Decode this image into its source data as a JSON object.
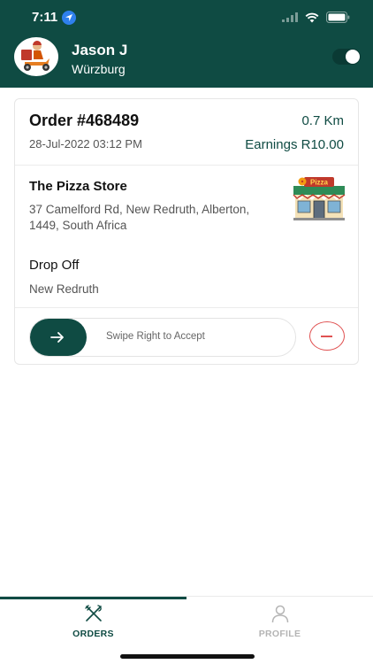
{
  "status_bar": {
    "time": "7:11",
    "icons": [
      "location-arrow-icon",
      "cellular-signal-icon",
      "wifi-icon",
      "battery-icon"
    ]
  },
  "header": {
    "driver_name": "Jason J",
    "driver_city": "Würzburg",
    "online_toggle": true,
    "avatar_icon": "delivery-scooter-avatar-icon",
    "colors": {
      "brand": "#0f4b43",
      "reject": "#e05252"
    }
  },
  "order": {
    "id": "Order #468489",
    "distance": "0.7 Km",
    "date": "28-Jul-2022 03:12 PM",
    "earnings": "Earnings R10.00",
    "store": {
      "name": "The Pizza Store",
      "address": "37 Camelford Rd, New Redruth, Alberton, 1449, South Africa",
      "sign_text": "Pizza"
    },
    "dropoff": {
      "title": "Drop Off",
      "place": "New Redruth"
    }
  },
  "actions": {
    "swipe_label": "Swipe Right to Accept",
    "swipe_icon": "arrow-right-icon",
    "reject_icon": "minus-circle-icon"
  },
  "tabs": [
    {
      "label": "ORDERS",
      "icon": "fork-knife-icon",
      "active": true
    },
    {
      "label": "PROFILE",
      "icon": "user-icon",
      "active": false
    }
  ]
}
